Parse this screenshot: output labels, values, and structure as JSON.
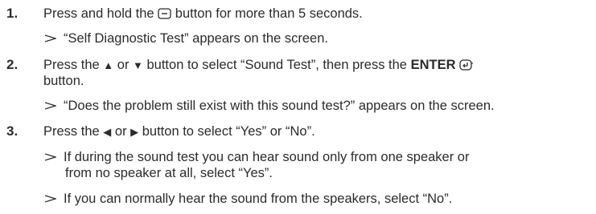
{
  "steps": [
    {
      "number": "1.",
      "text_a": "Press and hold the",
      "text_b": "button for more than 5 seconds.",
      "note": "“Self Diagnostic Test” appears on the screen."
    },
    {
      "number": "2.",
      "text_a": "Press the",
      "up_glyph": "▲",
      "text_b": "or",
      "down_glyph": "▼",
      "text_c": "button to select “Sound Test”, then press the",
      "enter_label": "ENTER",
      "text_d": "button.",
      "note": "“Does the problem still exist with this sound test?” appears on the screen."
    },
    {
      "number": "3.",
      "text_a": "Press the",
      "left_glyph": "◀",
      "text_b": "or",
      "right_glyph": "▶",
      "text_c": "button to select “Yes” or “No”.",
      "note1_line1": "If during the sound test you can hear sound only from one speaker or",
      "note1_line2": "from no speaker at all, select “Yes”.",
      "note2": "If you can normally hear the sound from the speakers, select “No”."
    }
  ],
  "icons": {
    "minus_button": "minus-button-icon",
    "enter_button": "enter-icon",
    "note_arrow": "arrow-right-icon"
  }
}
